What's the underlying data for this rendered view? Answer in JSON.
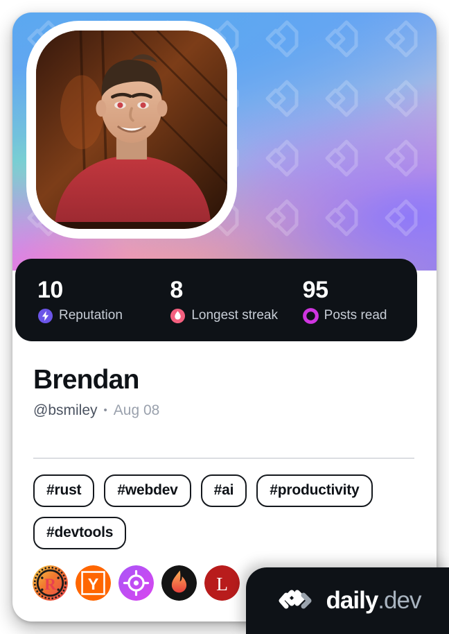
{
  "card": {
    "cover": {
      "watermark_icon": "daily-dev-mark",
      "gradient_colors": [
        "#5aa8ef",
        "#6da3f4",
        "#78dcc8",
        "#ee6ee6",
        "#ffaf78",
        "#8f86ef"
      ]
    },
    "avatar": {
      "alt": "Brendan profile photo",
      "border_color": "#ffffff"
    },
    "stats": [
      {
        "value": "10",
        "label": "Reputation",
        "icon": "reputation-bolt-icon",
        "color": "#6b55e8"
      },
      {
        "value": "8",
        "label": "Longest streak",
        "icon": "streak-flame-icon",
        "color": "#f4607f"
      },
      {
        "value": "95",
        "label": "Posts read",
        "icon": "posts-read-ring-icon",
        "color": "#cf35e0"
      }
    ],
    "identity": {
      "name": "Brendan",
      "handle": "@bsmiley",
      "separator": "•",
      "joined": "Aug 08"
    },
    "tags": [
      "#rust",
      "#webdev",
      "#ai",
      "#productivity",
      "#devtools"
    ],
    "badges": [
      {
        "name": "rust-badge",
        "label": "R"
      },
      {
        "name": "hacker-news-badge",
        "label": "Y"
      },
      {
        "name": "target-badge",
        "label": ""
      },
      {
        "name": "flame-badge",
        "label": ""
      },
      {
        "name": "lobsters-badge",
        "label": "L"
      }
    ],
    "brand": {
      "logo_icon": "daily-dev-logo",
      "name": "daily",
      "tld": ".dev"
    }
  }
}
